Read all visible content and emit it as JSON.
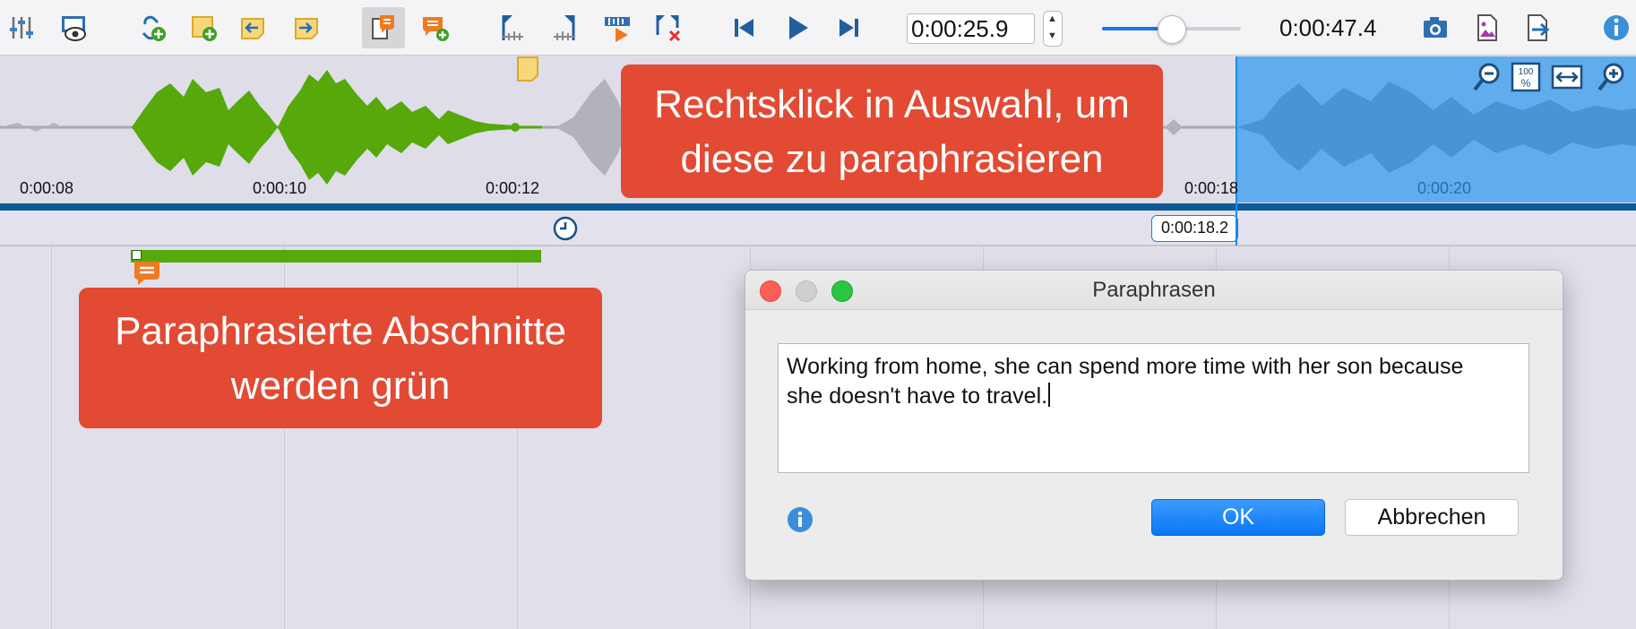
{
  "toolbar": {
    "current_time": "0:00:25.9",
    "total_time": "0:00:47.4",
    "volume_percent": 50,
    "icons": [
      "settings-sliders-icon",
      "video-preview-icon",
      "add-link-icon",
      "add-memo-icon",
      "previous-memo-icon",
      "next-memo-icon",
      "paraphrase-mode-icon",
      "add-paraphrase-icon",
      "set-start-icon",
      "set-end-icon",
      "play-selection-icon",
      "delete-mark-icon",
      "skip-back-icon",
      "play-icon",
      "skip-forward-icon",
      "snapshot-icon",
      "export-image-icon",
      "export-file-icon",
      "info-icon"
    ]
  },
  "waveform": {
    "ticks": [
      "0:00:08",
      "0:00:10",
      "0:00:12",
      "0:00:18",
      "0:00:20"
    ],
    "selection_time": "0:00:18.2",
    "zoom_icons": [
      "zoom-out-icon",
      "zoom-100-icon",
      "fit-width-icon",
      "zoom-in-icon"
    ],
    "zoom_100_label": "100"
  },
  "callouts": {
    "top": [
      "Rechtsklick in Auswahl, um",
      "diese zu paraphrasieren"
    ],
    "bottom": [
      "Paraphrasierte Abschnitte",
      "werden grün"
    ]
  },
  "dialog": {
    "title": "Paraphrasen",
    "text_line1": "Working from home, she can spend more time with her son because",
    "text_line2": "she doesn't have to travel.",
    "ok_label": "OK",
    "cancel_label": "Abbrechen"
  },
  "colors": {
    "accent": "#1a73e8",
    "callout": "#e24a33",
    "paraphrased": "#56a80b",
    "selection": "#5aa9ec"
  }
}
